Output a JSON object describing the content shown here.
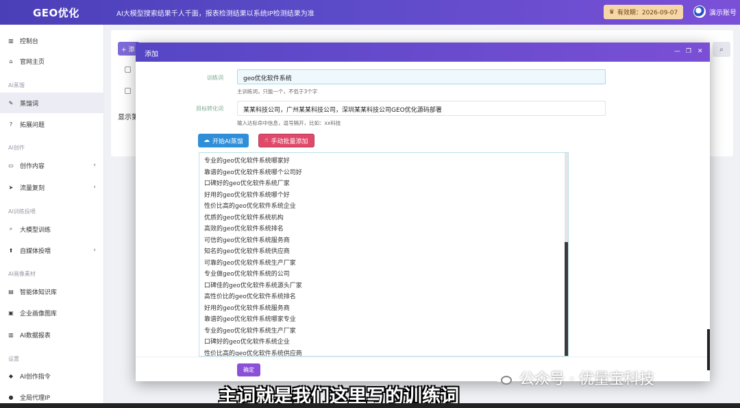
{
  "header": {
    "logo": "GEO优化",
    "notice": "AI大模型搜索结果千人千面，报表检测结果以系统IP检测结果为准",
    "expiry_label": "有效期：2026-09-07",
    "user_label": "演示账号"
  },
  "sidebar": {
    "items": [
      {
        "label": "控制台",
        "icon": "chart-icon"
      },
      {
        "label": "官网主页",
        "icon": "home-icon"
      },
      {
        "group": "AI蒸馏"
      },
      {
        "label": "蒸馏词",
        "icon": "link-icon",
        "active": true
      },
      {
        "label": "拓展问题",
        "icon": "question-icon"
      },
      {
        "group": "AI创作"
      },
      {
        "label": "创作内容",
        "icon": "folder-icon",
        "chevron": "‹"
      },
      {
        "label": "流量复刻",
        "icon": "rocket-icon",
        "chevron": "‹"
      },
      {
        "group": "AI训练投喂"
      },
      {
        "label": "大模型训练",
        "icon": "search-icon"
      },
      {
        "label": "自媒体投喂",
        "icon": "upload-icon",
        "chevron": "‹"
      },
      {
        "group": "AI画像素材"
      },
      {
        "label": "智能体知识库",
        "icon": "book-icon"
      },
      {
        "label": "企业画像图库",
        "icon": "image-icon"
      },
      {
        "label": "AI数据报表",
        "icon": "report-icon"
      },
      {
        "group": "设置"
      },
      {
        "label": "AI创作指令",
        "icon": "command-icon"
      },
      {
        "label": "全局代理IP",
        "icon": "globe-icon"
      }
    ]
  },
  "main": {
    "add_label": "+ 添",
    "showing_label": "显示第"
  },
  "modal": {
    "title": "添加",
    "controls": [
      "—",
      "❐",
      "✕"
    ],
    "train_label": "训练词",
    "train_value": "geo优化软件系统",
    "train_hint": "主训练词，只能一个，不低于3个字",
    "target_label": "目标转化词",
    "target_value": "某某科技公司，广州某某科技公司，深圳某某科技公司GEO优化源码部署",
    "target_hint": "输入达标命中信息，逗号隔开，比如：xx科技",
    "btn_ai": "开始AI蒸馏",
    "btn_manual": "手动批量添加",
    "results": [
      "专业的geo优化软件系统哪家好",
      "靠谱的geo优化软件系统哪个公司好",
      "口碑好的geo优化软件系统厂家",
      "好用的geo优化软件系统哪个好",
      "性价比高的geo优化软件系统企业",
      "优质的geo优化软件系统机构",
      "高效的geo优化软件系统排名",
      "可信的geo优化软件系统服务商",
      "知名的geo优化软件系统供应商",
      "可靠的geo优化软件系统生产厂家",
      "专业做geo优化软件系统的公司",
      "口碑佳的geo优化软件系统源头厂家",
      "高性价比的geo优化软件系统排名",
      "好用的geo优化软件系统服务商",
      "靠谱的geo优化软件系统哪家专业",
      "专业的geo优化软件系统生产厂家",
      "口碑好的geo优化软件系统企业",
      "性价比高的geo优化软件系统供应商"
    ],
    "confirm_label": "确定"
  },
  "overlay": {
    "watermark": "公众号 · 优量宝科技",
    "subtitle": "主词就是我们这里写的训练词"
  },
  "colors": {
    "header_start": "#4b3fb8",
    "header_end": "#7b50d8",
    "expiry_bg": "#f6d7a8",
    "btn_blue": "#2e8fd8",
    "btn_red": "#e04a6a",
    "confirm": "#8b50d8"
  }
}
